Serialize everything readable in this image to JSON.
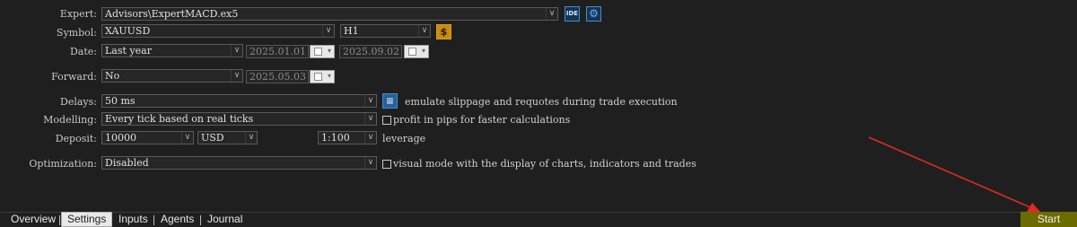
{
  "form": {
    "expert": {
      "label": "Expert:",
      "value": "Advisors\\ExpertMACD.ex5",
      "ide_label": "IDE"
    },
    "symbol": {
      "label": "Symbol:",
      "value": "XAUUSD",
      "timeframe": "H1"
    },
    "date": {
      "label": "Date:",
      "period": "Last year",
      "from": "2025.01.01",
      "to": "2025.09.02"
    },
    "forward": {
      "label": "Forward:",
      "value": "No",
      "date": "2025.05.03"
    },
    "delays": {
      "label": "Delays:",
      "value": "50 ms",
      "note": "emulate slippage and requotes during trade execution"
    },
    "modelling": {
      "label": "Modelling:",
      "value": "Every tick based on real ticks",
      "note": "profit in pips for faster calculations"
    },
    "deposit": {
      "label": "Deposit:",
      "value": "10000",
      "currency": "USD",
      "leverage": "1:100",
      "leverage_label": "leverage"
    },
    "optimization": {
      "label": "Optimization:",
      "value": "Disabled",
      "note": "visual mode with the display of charts, indicators and trades"
    }
  },
  "tabs": [
    "Overview",
    "Settings",
    "Inputs",
    "Agents",
    "Journal"
  ],
  "active_tab": "Settings",
  "start_label": "Start",
  "icons": {
    "settings": "gear-icon",
    "execution": "sliders-icon",
    "symbol_spec": "dollar-icon",
    "calendar": "calendar-icon"
  },
  "colors": {
    "background": "#1f1f1f",
    "start_button": "#6b6b00",
    "accent": "#3c8fd6",
    "arrow": "#e02a1e"
  }
}
